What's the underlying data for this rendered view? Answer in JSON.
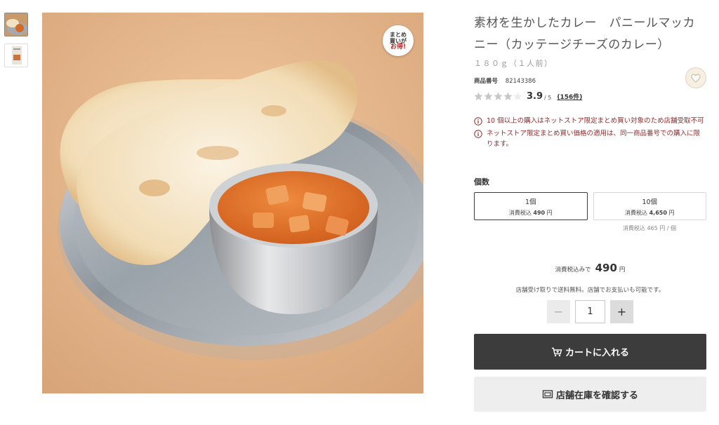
{
  "thumbnails": [
    {
      "icon": "curry-plate-thumbnail"
    },
    {
      "icon": "package-thumbnail"
    }
  ],
  "image": {
    "badge": {
      "line1": "まとめ",
      "line2": "買いが",
      "line3": "お得!"
    }
  },
  "product": {
    "title": "素材を生かしたカレー　パニールマッカニー（カッテージチーズのカレー）",
    "weight": "１８０ｇ（１人前）",
    "number_label": "商品番号",
    "number": "82143386",
    "rating": {
      "stars": 3.9,
      "score": "3.9",
      "out_of": "/ 5",
      "reviews": "(156件)"
    }
  },
  "notices": [
    "10 個以上の購入はネットストア限定まとめ買い対象のため店舗受取不可",
    "ネットストア限定まとめ買い価格の適用は、同一商品番号での購入に限ります。"
  ],
  "quantity": {
    "label": "個数",
    "options": [
      {
        "title": "1個",
        "price_prefix": "消費税込 ",
        "price": "490",
        "price_suffix": " 円",
        "selected": true
      },
      {
        "title": "10個",
        "price_prefix": "消費税込 ",
        "price": "4,650",
        "price_suffix": " 円",
        "selected": false
      }
    ],
    "unit_note": "消費税込 465 円 / 個"
  },
  "total": {
    "prefix": "消費税込みで",
    "amount": "490",
    "suffix": "円"
  },
  "shipping_note": "店舗受け取りで送料無料。店舗でお支払いも可能です。",
  "stepper": {
    "minus": "−",
    "value": "1",
    "plus": "+"
  },
  "buttons": {
    "cart": "カートに入れる",
    "store": "店舗在庫を確認する"
  },
  "colors": {
    "cart_bg": "#3c3c3c",
    "notice_text": "#8f2b2b",
    "star_fill": "#c8c8c8"
  }
}
